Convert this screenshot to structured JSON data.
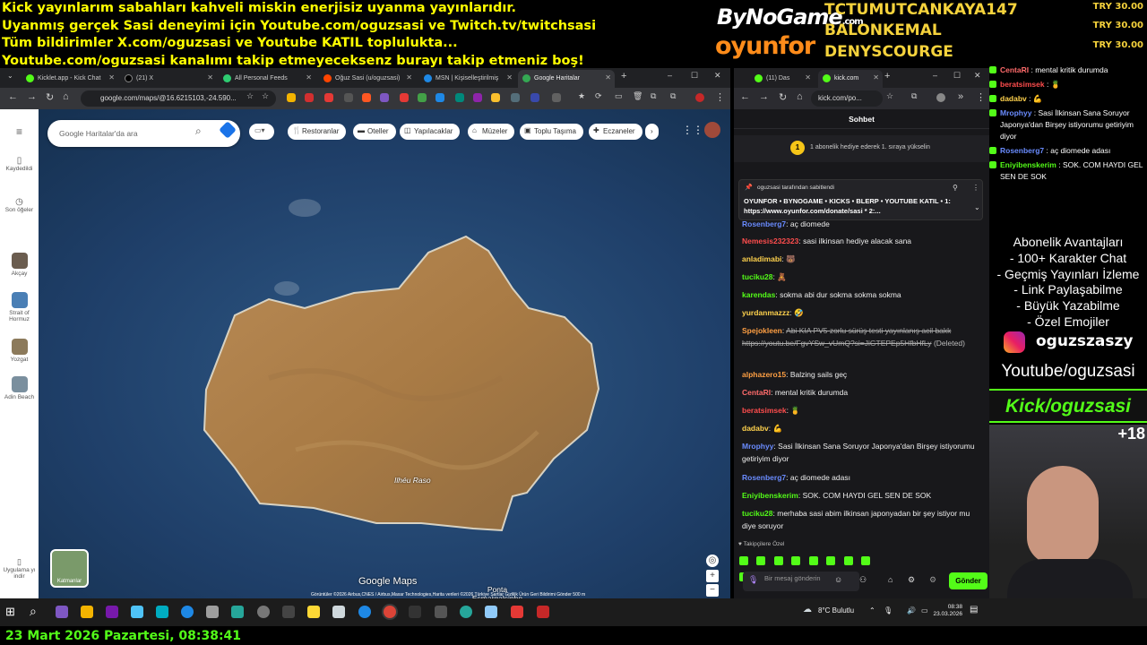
{
  "banner": {
    "line1": "Kick yayınlarım sabahları kahveli miskin enerjisiz uyanma yayınlarıdır.",
    "line2": "Uyanmış gerçek Sasi deneyimi için Youtube.com/oguzsasi ve Twitch.tv/twitchsasi",
    "line3": "Tüm bildirimler X.com/oguzsasi ve Youtube KATIL toplulukta...",
    "line4": "Youtube.com/oguzsasi kanalımı takip etmeyeceksenz burayı takip etmeniz boş!"
  },
  "sponsors": {
    "logo1": "ByNoGame",
    "logo1_suffix": ".com",
    "logo2": "oyunfor"
  },
  "donors": [
    {
      "name": "TCTUMUTCANKAYA147",
      "amount": "TRY 30.00"
    },
    {
      "name": "BALONKEMAL",
      "amount": "TRY 30.00"
    },
    {
      "name": "DENYSCOURGE",
      "amount": "TRY 30.00"
    }
  ],
  "browser1": {
    "tabs": [
      {
        "label": "Kicklet.app - Kick Chat",
        "color": "#53fc18"
      },
      {
        "label": "(21) X",
        "color": "#000000"
      },
      {
        "label": "All Personal Feeds",
        "color": "#2ecc71"
      },
      {
        "label": "Oğuz Sasi (u/oguzsasi)",
        "color": "#ff4500"
      },
      {
        "label": "MSN | Kişiselleştirilmiş",
        "color": "#1e88e5"
      },
      {
        "label": "Google Haritalar",
        "color": "#34a853"
      }
    ],
    "url": "google.com/maps/@16.6215103,-24.590...",
    "search_placeholder": "Google Haritalar'da ara",
    "chips": [
      "Restoranlar",
      "Oteller",
      "Yapılacaklar",
      "Müzeler",
      "Toplu Taşıma",
      "Eczaneler"
    ],
    "rail": [
      "Kaydedildi",
      "Son öğeler",
      "Akçay",
      "Strait of Hormuz",
      "Yozgat",
      "Adin Beach",
      "Uygulama yı indir"
    ],
    "layers_label": "Katmanlar",
    "map_labels": {
      "island": "Ilhéu Raso",
      "point": "Ponta Esmargalsinho"
    },
    "logo": "Google Maps",
    "attribution": "Görüntüler ©2026 Airbus,CNES / Airbus,Maxar Technologies,Harita verileri ©2026   Türkiye   Şartlar   Gizlilik   Ürün Geri Bildirimi Gönder   500 m"
  },
  "browser2": {
    "tabs": [
      {
        "label": "(11) Das"
      },
      {
        "label": "kick.com"
      }
    ],
    "url": "kick.com/po...",
    "title": "Sohbet",
    "sub_notice": "1 abonelik hediye ederek 1. sıraya yükselin",
    "sub_rank": "1",
    "pinned_by": "oguzsasi tarafından sabitlendi",
    "pinned_text": "OYUNFOR • BYNOGAME • KICKS • BLERP • YOUTUBE KATIL • 1: https://www.oyunfor.com/donate/sasi * 2:...",
    "messages": [
      {
        "user": "Rosenberg7",
        "color": "#6a8cff",
        "text": "aç diomede"
      },
      {
        "user": "Nemesis232323",
        "color": "#ff4d4d",
        "text": "sasi ilkinsan hediye alacak sana"
      },
      {
        "user": "anladimabi",
        "color": "#ffd24d",
        "text": "🐻"
      },
      {
        "user": "tuciku28",
        "color": "#53fc18",
        "text": "🧸"
      },
      {
        "user": "karendas",
        "color": "#53fc18",
        "text": "sokma abi dur sokma sokma sokma"
      },
      {
        "user": "yurdanmazzz",
        "color": "#ffd24d",
        "text": "🤣"
      },
      {
        "user": "Spejokleen",
        "color": "#ff9f43",
        "text": "Abi KIA PV5 zorlu sürüş testi yayınlanış acil bakk https://youtu.be/FgvYSw_vUmQ?si=JiGTEPEp5HfbHfLy",
        "deleted": "(Deleted)"
      },
      {
        "user": "alphazero15",
        "color": "#ff9f43",
        "text": "Balzing sails geç"
      },
      {
        "user": "CentaRI",
        "color": "#ff6b6b",
        "text": "mental kritik durumda"
      },
      {
        "user": "beratsimsek",
        "color": "#ff4d4d",
        "text": "🍍"
      },
      {
        "user": "dadabv",
        "color": "#ffd24d",
        "text": "💪"
      },
      {
        "user": "Mrophyy",
        "color": "#6a8cff",
        "text": "Sasi İlkinsan Sana Soruyor Japonya'dan Birşey istiyorumu getiriyim diyor"
      },
      {
        "user": "Rosenberg7",
        "color": "#6a8cff",
        "text": "aç diomede adası"
      },
      {
        "user": "Eniyibenskerim",
        "color": "#53fc18",
        "text": "SOK. COM HAYDI GEL SEN DE SOK"
      },
      {
        "user": "tuciku28",
        "color": "#53fc18",
        "text": "merhaba sasi abim ilkinsan japonyadan bir şey istiyor mu diye soruyor"
      }
    ],
    "followers_label": "Takipçilere Özel",
    "input_placeholder": "Bir mesaj gönderin",
    "send_label": "Gönder"
  },
  "overlay_chat": [
    {
      "user": "CentaRI",
      "color": "#ff6b6b",
      "text": "mental kritik durumda"
    },
    {
      "user": "beratsimsek",
      "color": "#ff4d4d",
      "text": "🍍"
    },
    {
      "user": "dadabv",
      "color": "#ffd24d",
      "text": "💪"
    },
    {
      "user": "Mrophyy",
      "color": "#6a8cff",
      "text": "Sasi İlkinsan Sana Soruyor Japonya'dan Birşey istiyorumu getiriyim diyor"
    },
    {
      "user": "Rosenberg7",
      "color": "#6a8cff",
      "text": "aç diomede adası"
    },
    {
      "user": "Eniyibenskerim",
      "color": "#53fc18",
      "text": "SOK. COM HAYDI GEL SEN DE SOK"
    }
  ],
  "perks": {
    "title": "Abonelik Avantajları",
    "items": [
      "- 100+ Karakter Chat",
      "- Geçmiş Yayınları İzleme",
      "- Link Paylaşabilme",
      "- Büyük Yazabilme",
      "- Özel Emojiler"
    ]
  },
  "instagram": "oguzszaszy",
  "youtube": "Youtube/oguzsasi",
  "kick": "Kick/oguzsasi",
  "age_badge": "+18",
  "taskbar": {
    "weather": "8°C  Bulutlu",
    "time": "08:38",
    "date": "23.03.2026"
  },
  "clock_text": "23 Mart 2026 Pazartesi, 08:38:41",
  "colors": {
    "kick_green": "#53fc18",
    "banner_yellow": "#ffff00",
    "donor_gold": "#f5d23c"
  }
}
